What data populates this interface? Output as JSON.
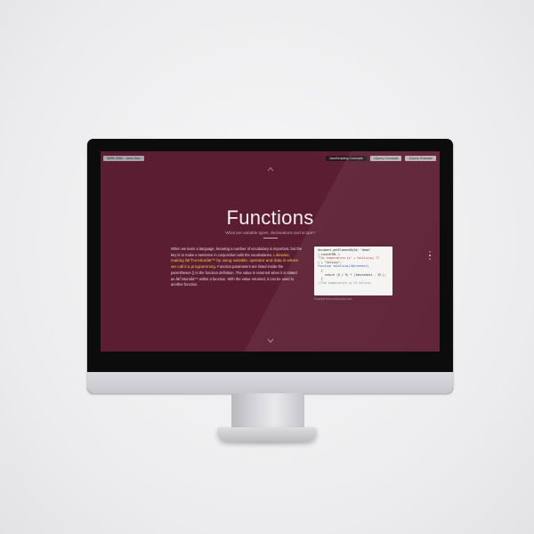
{
  "header": {
    "badge": "WEB 3394 · John Seo",
    "nav": [
      {
        "label": "JavaScripting Concepts",
        "active": true
      },
      {
        "label": "JQuery Concepts",
        "active": false
      },
      {
        "label": "JQuery Example",
        "active": false
      }
    ]
  },
  "slide": {
    "title": "Functions",
    "subtitle": "What are variable types, declarations and scope?",
    "body_before": "When we learn a language, knowing a number of vocabulary is important, but the key is to make a sentence in conjunction with the vocabularies. ",
    "body_highlight": "Likewise, making â€˜Functionâ€™ by using variable, operator and data is where we call it a programming.",
    "body_after": " Function parameters are listed inside the parentheses () in the function definition. The value is returned when it is stated as â€˜returnâ€™ within a function. With the value returned, it can be used to another function."
  },
  "code": {
    "lines": [
      "document.getElementById( \"demo\"",
      ").innerHTML =",
      "\"The temperature is\" + toCelsius( 77",
      ") + \"Celsius\";",
      "",
      "function toCelsius(fahrenheit)",
      "  {",
      "    return (5 / 9) * (fahrenheit - 32 );",
      "  }",
      "",
      "//The temperature is 25 Celsius"
    ],
    "caption": "Example from w3schools.com"
  },
  "icons": {
    "up": "chevron-up-icon",
    "down": "chevron-down-icon"
  },
  "colors": {
    "slide_background": "#5a1d32",
    "highlight": "#f0c84e"
  }
}
